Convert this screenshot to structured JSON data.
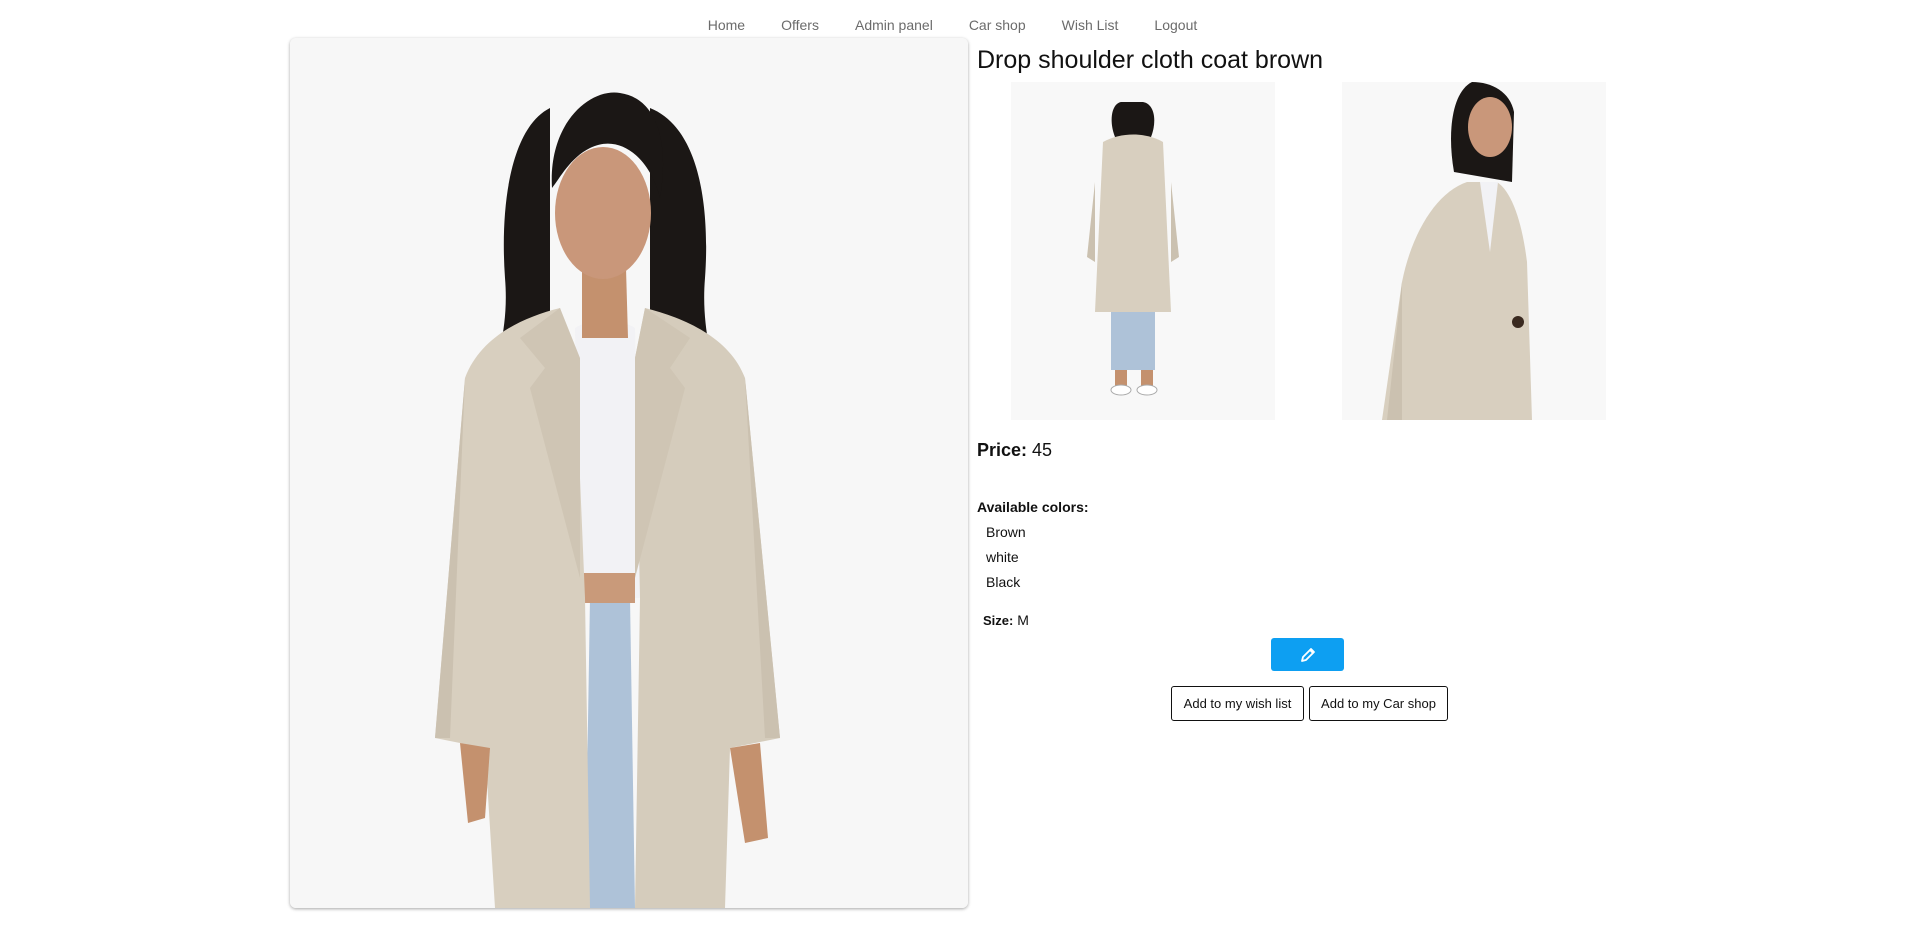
{
  "nav": {
    "items": [
      {
        "label": "Home"
      },
      {
        "label": "Offers"
      },
      {
        "label": "Admin panel"
      },
      {
        "label": "Car shop"
      },
      {
        "label": "Wish List"
      },
      {
        "label": "Logout"
      }
    ]
  },
  "product": {
    "title": "Drop shoulder cloth coat brown",
    "price_label": "Price:",
    "price": "45",
    "colors_label": "Available colors:",
    "colors": [
      "Brown",
      "white",
      "Black"
    ],
    "size_label": "Size:",
    "size": "M"
  },
  "actions": {
    "edit_icon": "pencil-icon",
    "wish_label": "Add to my wish list",
    "cart_label": "Add to my Car shop"
  },
  "colors": {
    "accent": "#0d9ff2",
    "coat": "#d8cfbf",
    "nav_text": "#6b6b6b"
  }
}
